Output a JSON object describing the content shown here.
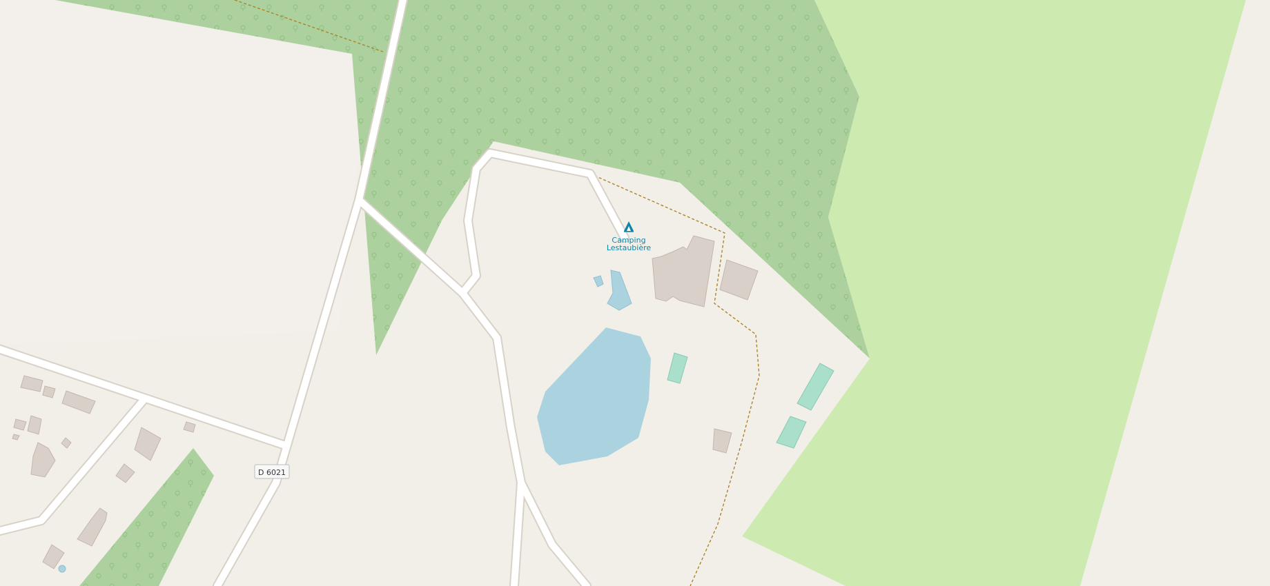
{
  "map": {
    "poi": {
      "name_line1": "Camping",
      "name_line2": "Lestaubière",
      "icon": "campsite-icon",
      "color": "#0e85a6"
    },
    "road_ref": "D 6021",
    "colors": {
      "background": "#f2efe9",
      "forest": "#add19e",
      "meadow": "#cdebb0",
      "water": "#aad3df",
      "building": "#d9d0c9",
      "pitch": "#aae0cb",
      "road": "#ffffff",
      "track": "#ac8327"
    }
  }
}
